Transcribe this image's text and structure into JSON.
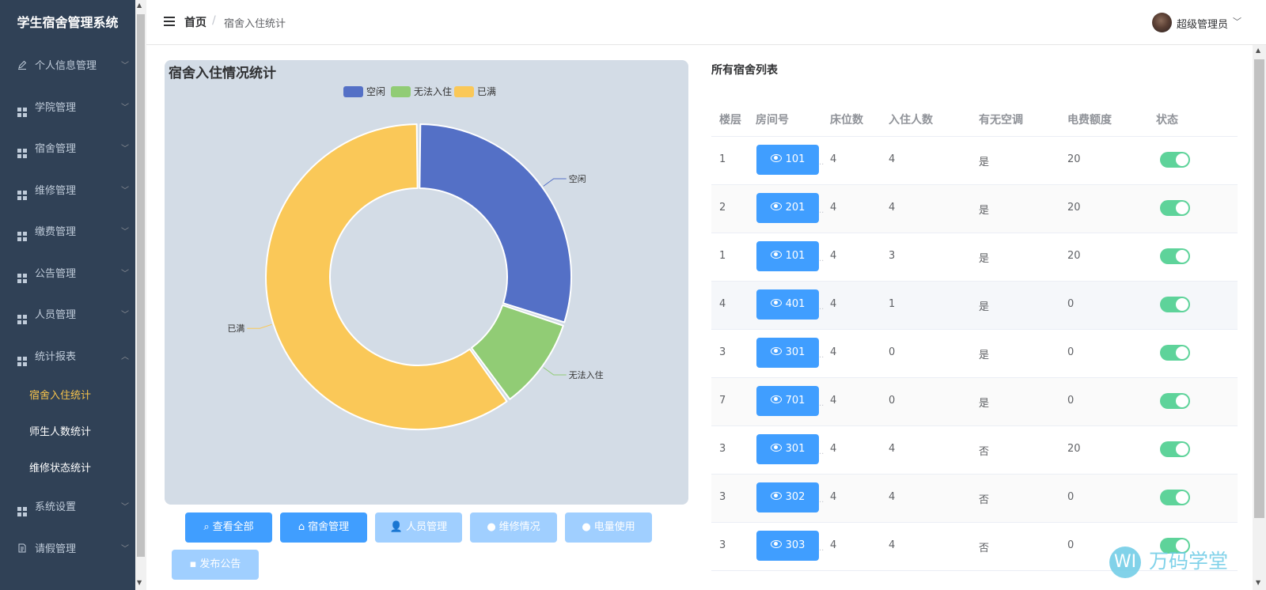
{
  "app": {
    "title": "学生宿舍管理系统"
  },
  "sidebar": {
    "items": [
      {
        "label": "个人信息管理",
        "icon": "edit-icon"
      },
      {
        "label": "学院管理",
        "icon": "grid-icon"
      },
      {
        "label": "宿舍管理",
        "icon": "grid-icon"
      },
      {
        "label": "维修管理",
        "icon": "grid-icon"
      },
      {
        "label": "缴费管理",
        "icon": "grid-icon"
      },
      {
        "label": "公告管理",
        "icon": "grid-icon"
      },
      {
        "label": "人员管理",
        "icon": "grid-icon"
      },
      {
        "label": "统计报表",
        "icon": "grid-icon",
        "expanded": true
      }
    ],
    "sub_items": [
      {
        "label": "宿舍入住统计",
        "active": true
      },
      {
        "label": "师生人数统计"
      },
      {
        "label": "维修状态统计"
      }
    ],
    "bottom_items": [
      {
        "label": "系统设置",
        "icon": "grid-icon"
      },
      {
        "label": "请假管理",
        "icon": "document-icon"
      }
    ],
    "colors": {
      "background": "#304156",
      "active_text": "#f7c34b"
    }
  },
  "header": {
    "breadcrumb": {
      "home": "首页",
      "separator": "/",
      "current": "宿舍入住统计"
    },
    "user": {
      "name": "超级管理员",
      "caret": "﹀"
    }
  },
  "chart_panel": {
    "title": "宿舍入住情况统计",
    "chart_data": {
      "type": "pie",
      "style": "donut",
      "legend_position": "top-center",
      "labels": [
        "空闲",
        "无法入住",
        "已满"
      ],
      "values": [
        3,
        1,
        6
      ],
      "colors": [
        "#5470c6",
        "#91cc75",
        "#fac858"
      ]
    }
  },
  "actions": [
    {
      "label": "查看全部",
      "icon": "search-icon",
      "glyph": "⌕",
      "active": true
    },
    {
      "label": "宿舍管理",
      "icon": "home-icon",
      "glyph": "⌂",
      "active": true
    },
    {
      "label": "人员管理",
      "icon": "user-icon",
      "glyph": "👤",
      "active": false
    },
    {
      "label": "维修情况",
      "icon": "info-icon",
      "glyph": "●",
      "active": false
    },
    {
      "label": "电量使用",
      "icon": "bulb-icon",
      "glyph": "●",
      "active": false
    },
    {
      "label": "发布公告",
      "icon": "message-icon",
      "glyph": "▪",
      "active": false
    }
  ],
  "dorm_list": {
    "title": "所有宿舍列表",
    "columns": [
      "楼层",
      "房间号",
      "床位数",
      "入住人数",
      "有无空调",
      "电费额度",
      "状态"
    ],
    "rows": [
      {
        "floor": "1",
        "room": "101",
        "beds": "4",
        "occupants": "4",
        "ac": "是",
        "quota": "20",
        "status": true
      },
      {
        "floor": "2",
        "room": "201",
        "beds": "4",
        "occupants": "4",
        "ac": "是",
        "quota": "20",
        "status": true
      },
      {
        "floor": "1",
        "room": "101",
        "beds": "4",
        "occupants": "3",
        "ac": "是",
        "quota": "20",
        "status": true
      },
      {
        "floor": "4",
        "room": "401",
        "beds": "4",
        "occupants": "1",
        "ac": "是",
        "quota": "0",
        "status": true
      },
      {
        "floor": "3",
        "room": "301",
        "beds": "4",
        "occupants": "0",
        "ac": "是",
        "quota": "0",
        "status": true
      },
      {
        "floor": "7",
        "room": "701",
        "beds": "4",
        "occupants": "0",
        "ac": "是",
        "quota": "0",
        "status": true
      },
      {
        "floor": "3",
        "room": "301",
        "beds": "4",
        "occupants": "4",
        "ac": "否",
        "quota": "20",
        "status": true
      },
      {
        "floor": "3",
        "room": "302",
        "beds": "4",
        "occupants": "4",
        "ac": "否",
        "quota": "0",
        "status": true
      },
      {
        "floor": "3",
        "room": "303",
        "beds": "4",
        "occupants": "4",
        "ac": "否",
        "quota": "0",
        "status": true
      }
    ],
    "switch_color": "#5ed39a"
  },
  "watermark": {
    "logo": "WI",
    "text": "万码学堂"
  }
}
